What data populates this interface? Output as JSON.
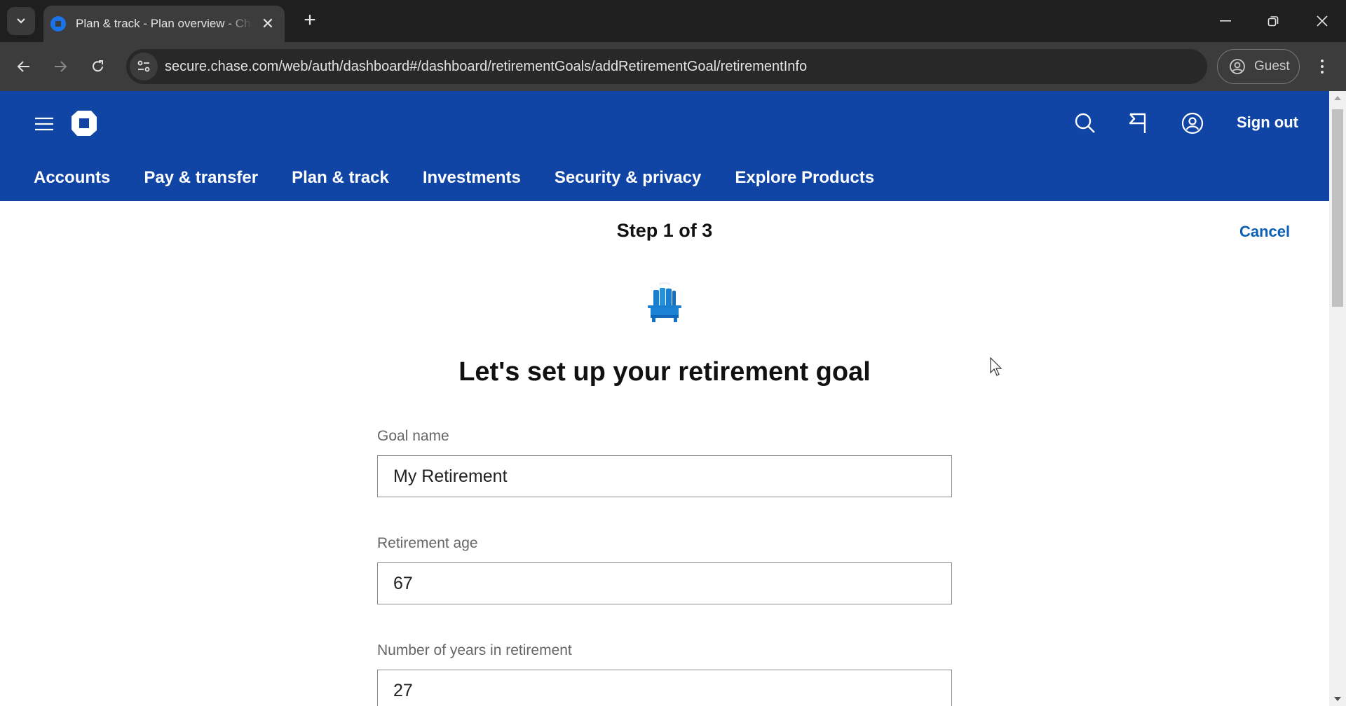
{
  "browser": {
    "tab_title": "Plan & track - Plan overview - Chase",
    "url": "secure.chase.com/web/auth/dashboard#/dashboard/retirementGoals/addRetirementGoal/retirementInfo",
    "profile_label": "Guest",
    "icons": {
      "tab_list": "chevron-down-icon",
      "favicon": "chase-favicon",
      "tab_close": "close-icon",
      "new_tab": "plus-icon",
      "minimize": "minimize-icon",
      "restore": "restore-icon",
      "close_window": "close-icon",
      "back": "arrow-left-icon",
      "forward": "arrow-right-icon",
      "reload": "reload-icon",
      "site_info": "tune-icon",
      "profile": "person-circle-icon",
      "menu": "kebab-icon"
    }
  },
  "header": {
    "sign_out_label": "Sign out",
    "icons": [
      "menu-icon",
      "chase-logo",
      "search-icon",
      "flag-icon",
      "profile-icon"
    ],
    "brand_color": "#1045a6",
    "nav": [
      {
        "label": "Accounts"
      },
      {
        "label": "Pay & transfer"
      },
      {
        "label": "Plan & track"
      },
      {
        "label": "Investments"
      },
      {
        "label": "Security & privacy"
      },
      {
        "label": "Explore Products"
      }
    ]
  },
  "wizard": {
    "step_label": "Step 1 of 3",
    "cancel_label": "Cancel",
    "illustration": "beach-chair-icon",
    "title": "Let's set up your retirement goal",
    "fields": [
      {
        "label": "Goal name",
        "value": "My Retirement"
      },
      {
        "label": "Retirement age",
        "value": "67"
      },
      {
        "label": "Number of years in retirement",
        "value": "27"
      }
    ]
  }
}
